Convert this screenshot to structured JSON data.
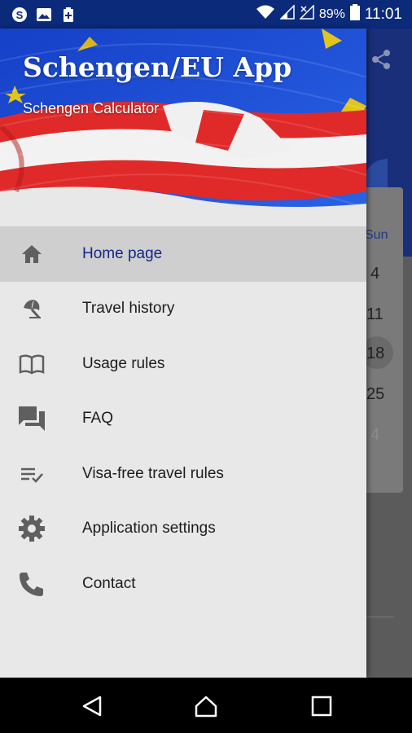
{
  "status_bar": {
    "left_icons": [
      "skype-icon",
      "image-icon",
      "battery-plus-icon"
    ],
    "battery_percent": "89%",
    "time": "11:01"
  },
  "background_app": {
    "calendar_header": "Sun",
    "calendar_days": [
      "4",
      "11",
      "18",
      "25",
      "4"
    ]
  },
  "drawer": {
    "title": "Schengen/EU App",
    "subtitle": "Schengen Calculator",
    "items": [
      {
        "label": "Home page",
        "icon": "home-icon",
        "active": true
      },
      {
        "label": "Travel history",
        "icon": "beach-umbrella-icon",
        "active": false
      },
      {
        "label": "Usage rules",
        "icon": "book-icon",
        "active": false
      },
      {
        "label": "FAQ",
        "icon": "chat-icon",
        "active": false
      },
      {
        "label": "Visa-free travel rules",
        "icon": "checklist-icon",
        "active": false
      },
      {
        "label": "Application settings",
        "icon": "gear-icon",
        "active": false
      },
      {
        "label": "Contact",
        "icon": "phone-icon",
        "active": false
      }
    ]
  },
  "nav_bar": {
    "buttons": [
      "back-icon",
      "home-icon",
      "recents-icon"
    ]
  },
  "colors": {
    "status_bar": "#0b2a7a",
    "active_label": "#14268a",
    "drawer_bg": "#e8e8e8",
    "active_bg": "#cfcfcf",
    "icon": "#5f5f5f"
  }
}
